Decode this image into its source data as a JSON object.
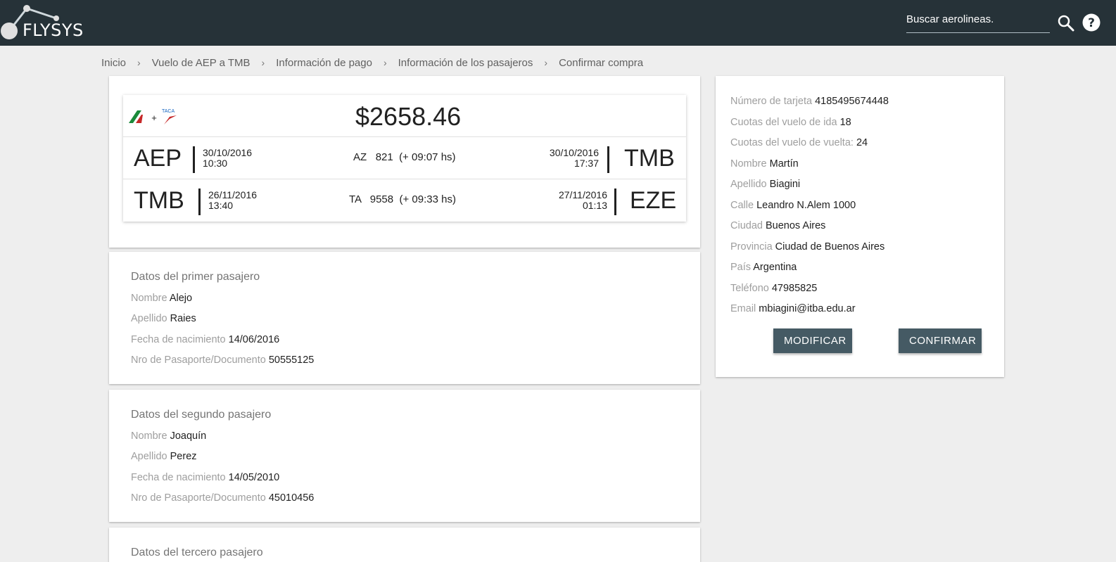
{
  "header": {
    "logo_text": "FLYSYS",
    "search_placeholder": "Buscar aerolineas.",
    "search_icon": "search-icon",
    "help_icon": "help-icon"
  },
  "breadcrumb": [
    "Inicio",
    "Vuelo de AEP a TMB",
    "Información de pago",
    "Información de los pasajeros",
    "Confirmar compra"
  ],
  "flight": {
    "price": "$2658.46",
    "airline_logos": [
      "alitalia-logo",
      "taca-logo"
    ],
    "plus_sign": "+",
    "taca_text": "TACA",
    "legs": [
      {
        "from": "AEP",
        "dep_date": "30/10/2016",
        "dep_time": "10:30",
        "airline": "AZ",
        "number": "821",
        "duration": "(+ 09:07 hs)",
        "arr_date": "30/10/2016",
        "arr_time": "17:37",
        "to": "TMB"
      },
      {
        "from": "TMB",
        "dep_date": "26/11/2016",
        "dep_time": "13:40",
        "airline": "TA",
        "number": "9558",
        "duration": "(+ 09:33 hs)",
        "arr_date": "27/11/2016",
        "arr_time": "01:13",
        "to": "EZE"
      }
    ]
  },
  "passengers": [
    {
      "title": "Datos del primer pasajero",
      "nombre_label": "Nombre",
      "nombre": "Alejo",
      "apellido_label": "Apellido",
      "apellido": "Raies",
      "fecha_label": "Fecha de nacimiento",
      "fecha": "14/06/2016",
      "doc_label": "Nro de Pasaporte/Documento",
      "doc": "50555125"
    },
    {
      "title": "Datos del segundo pasajero",
      "nombre_label": "Nombre",
      "nombre": "Joaquín",
      "apellido_label": "Apellido",
      "apellido": "Perez",
      "fecha_label": "Fecha de nacimiento",
      "fecha": "14/05/2010",
      "doc_label": "Nro de Pasaporte/Documento",
      "doc": "45010456"
    },
    {
      "title": "Datos del tercero pasajero"
    }
  ],
  "payment": {
    "rows": [
      {
        "label": "Número de tarjeta",
        "value": "4185495674448"
      },
      {
        "label": "Cuotas del vuelo de ida",
        "value": "18"
      },
      {
        "label": "Cuotas del vuelo de vuelta:",
        "value": "24"
      },
      {
        "label": "Nombre",
        "value": "Martín"
      },
      {
        "label": "Apellido",
        "value": "Biagini"
      },
      {
        "label": "Calle",
        "value": "Leandro N.Alem 1000"
      },
      {
        "label": "Ciudad",
        "value": "Buenos Aires"
      },
      {
        "label": "Provincia",
        "value": "Ciudad de Buenos Aires"
      },
      {
        "label": "País",
        "value": "Argentina"
      },
      {
        "label": "Teléfono",
        "value": "47985825"
      },
      {
        "label": "Email",
        "value": "mbiagini@itba.edu.ar"
      }
    ],
    "modify_label": "MODIFICAR",
    "confirm_label": "CONFIRMAR"
  },
  "colors": {
    "topbar": "#263238",
    "button": "#455a64",
    "background": "#eeeeee"
  }
}
